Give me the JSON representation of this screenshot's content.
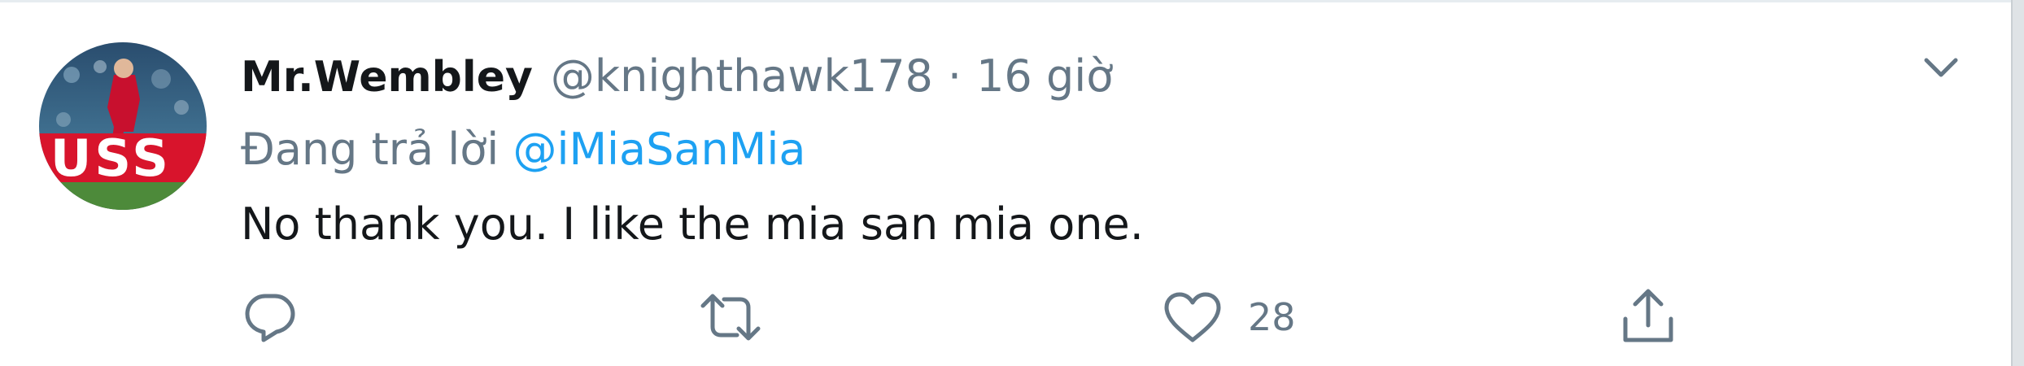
{
  "tweet": {
    "display_name": "Mr.Wembley",
    "handle": "@knighthawk178",
    "separator": "·",
    "time": "16 giờ",
    "reply_prefix": "Đang trả lời",
    "reply_to": "@iMiaSanMia",
    "text": "No thank you. I like the mia san mia one.",
    "avatar_text": "USS",
    "actions": {
      "reply_icon": "reply-icon",
      "retweet_icon": "retweet-icon",
      "like_icon": "heart-icon",
      "like_count": "28",
      "share_icon": "share-icon"
    },
    "menu_icon": "chevron-down-icon"
  },
  "colors": {
    "text_primary": "#14171a",
    "text_secondary": "#657786",
    "link": "#1da1f2",
    "border": "#e6ecf0"
  }
}
